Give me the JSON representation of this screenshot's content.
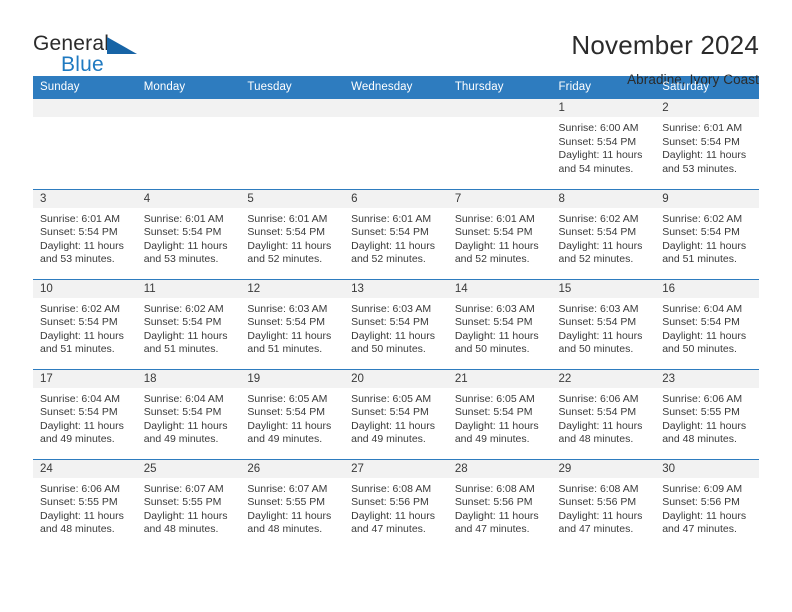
{
  "brand": {
    "name_part1": "General",
    "name_part2": "Blue",
    "logo_icon": "triangle-icon"
  },
  "header": {
    "title": "November 2024",
    "subtitle": "Abradine, Ivory Coast"
  },
  "colors": {
    "header_blue": "#2e7cbf",
    "brand_blue": "#1f7ac1",
    "daynum_background": "#f2f2f2",
    "text": "#3a3a3a"
  },
  "weekday_headers": [
    "Sunday",
    "Monday",
    "Tuesday",
    "Wednesday",
    "Thursday",
    "Friday",
    "Saturday"
  ],
  "weeks": [
    [
      {
        "day": "",
        "sunrise": "",
        "sunset": "",
        "daylight": "",
        "empty": true
      },
      {
        "day": "",
        "sunrise": "",
        "sunset": "",
        "daylight": "",
        "empty": true
      },
      {
        "day": "",
        "sunrise": "",
        "sunset": "",
        "daylight": "",
        "empty": true
      },
      {
        "day": "",
        "sunrise": "",
        "sunset": "",
        "daylight": "",
        "empty": true
      },
      {
        "day": "",
        "sunrise": "",
        "sunset": "",
        "daylight": "",
        "empty": true
      },
      {
        "day": "1",
        "sunrise": "Sunrise: 6:00 AM",
        "sunset": "Sunset: 5:54 PM",
        "daylight": "Daylight: 11 hours and 54 minutes.",
        "empty": false
      },
      {
        "day": "2",
        "sunrise": "Sunrise: 6:01 AM",
        "sunset": "Sunset: 5:54 PM",
        "daylight": "Daylight: 11 hours and 53 minutes.",
        "empty": false
      }
    ],
    [
      {
        "day": "3",
        "sunrise": "Sunrise: 6:01 AM",
        "sunset": "Sunset: 5:54 PM",
        "daylight": "Daylight: 11 hours and 53 minutes.",
        "empty": false
      },
      {
        "day": "4",
        "sunrise": "Sunrise: 6:01 AM",
        "sunset": "Sunset: 5:54 PM",
        "daylight": "Daylight: 11 hours and 53 minutes.",
        "empty": false
      },
      {
        "day": "5",
        "sunrise": "Sunrise: 6:01 AM",
        "sunset": "Sunset: 5:54 PM",
        "daylight": "Daylight: 11 hours and 52 minutes.",
        "empty": false
      },
      {
        "day": "6",
        "sunrise": "Sunrise: 6:01 AM",
        "sunset": "Sunset: 5:54 PM",
        "daylight": "Daylight: 11 hours and 52 minutes.",
        "empty": false
      },
      {
        "day": "7",
        "sunrise": "Sunrise: 6:01 AM",
        "sunset": "Sunset: 5:54 PM",
        "daylight": "Daylight: 11 hours and 52 minutes.",
        "empty": false
      },
      {
        "day": "8",
        "sunrise": "Sunrise: 6:02 AM",
        "sunset": "Sunset: 5:54 PM",
        "daylight": "Daylight: 11 hours and 52 minutes.",
        "empty": false
      },
      {
        "day": "9",
        "sunrise": "Sunrise: 6:02 AM",
        "sunset": "Sunset: 5:54 PM",
        "daylight": "Daylight: 11 hours and 51 minutes.",
        "empty": false
      }
    ],
    [
      {
        "day": "10",
        "sunrise": "Sunrise: 6:02 AM",
        "sunset": "Sunset: 5:54 PM",
        "daylight": "Daylight: 11 hours and 51 minutes.",
        "empty": false
      },
      {
        "day": "11",
        "sunrise": "Sunrise: 6:02 AM",
        "sunset": "Sunset: 5:54 PM",
        "daylight": "Daylight: 11 hours and 51 minutes.",
        "empty": false
      },
      {
        "day": "12",
        "sunrise": "Sunrise: 6:03 AM",
        "sunset": "Sunset: 5:54 PM",
        "daylight": "Daylight: 11 hours and 51 minutes.",
        "empty": false
      },
      {
        "day": "13",
        "sunrise": "Sunrise: 6:03 AM",
        "sunset": "Sunset: 5:54 PM",
        "daylight": "Daylight: 11 hours and 50 minutes.",
        "empty": false
      },
      {
        "day": "14",
        "sunrise": "Sunrise: 6:03 AM",
        "sunset": "Sunset: 5:54 PM",
        "daylight": "Daylight: 11 hours and 50 minutes.",
        "empty": false
      },
      {
        "day": "15",
        "sunrise": "Sunrise: 6:03 AM",
        "sunset": "Sunset: 5:54 PM",
        "daylight": "Daylight: 11 hours and 50 minutes.",
        "empty": false
      },
      {
        "day": "16",
        "sunrise": "Sunrise: 6:04 AM",
        "sunset": "Sunset: 5:54 PM",
        "daylight": "Daylight: 11 hours and 50 minutes.",
        "empty": false
      }
    ],
    [
      {
        "day": "17",
        "sunrise": "Sunrise: 6:04 AM",
        "sunset": "Sunset: 5:54 PM",
        "daylight": "Daylight: 11 hours and 49 minutes.",
        "empty": false
      },
      {
        "day": "18",
        "sunrise": "Sunrise: 6:04 AM",
        "sunset": "Sunset: 5:54 PM",
        "daylight": "Daylight: 11 hours and 49 minutes.",
        "empty": false
      },
      {
        "day": "19",
        "sunrise": "Sunrise: 6:05 AM",
        "sunset": "Sunset: 5:54 PM",
        "daylight": "Daylight: 11 hours and 49 minutes.",
        "empty": false
      },
      {
        "day": "20",
        "sunrise": "Sunrise: 6:05 AM",
        "sunset": "Sunset: 5:54 PM",
        "daylight": "Daylight: 11 hours and 49 minutes.",
        "empty": false
      },
      {
        "day": "21",
        "sunrise": "Sunrise: 6:05 AM",
        "sunset": "Sunset: 5:54 PM",
        "daylight": "Daylight: 11 hours and 49 minutes.",
        "empty": false
      },
      {
        "day": "22",
        "sunrise": "Sunrise: 6:06 AM",
        "sunset": "Sunset: 5:54 PM",
        "daylight": "Daylight: 11 hours and 48 minutes.",
        "empty": false
      },
      {
        "day": "23",
        "sunrise": "Sunrise: 6:06 AM",
        "sunset": "Sunset: 5:55 PM",
        "daylight": "Daylight: 11 hours and 48 minutes.",
        "empty": false
      }
    ],
    [
      {
        "day": "24",
        "sunrise": "Sunrise: 6:06 AM",
        "sunset": "Sunset: 5:55 PM",
        "daylight": "Daylight: 11 hours and 48 minutes.",
        "empty": false
      },
      {
        "day": "25",
        "sunrise": "Sunrise: 6:07 AM",
        "sunset": "Sunset: 5:55 PM",
        "daylight": "Daylight: 11 hours and 48 minutes.",
        "empty": false
      },
      {
        "day": "26",
        "sunrise": "Sunrise: 6:07 AM",
        "sunset": "Sunset: 5:55 PM",
        "daylight": "Daylight: 11 hours and 48 minutes.",
        "empty": false
      },
      {
        "day": "27",
        "sunrise": "Sunrise: 6:08 AM",
        "sunset": "Sunset: 5:56 PM",
        "daylight": "Daylight: 11 hours and 47 minutes.",
        "empty": false
      },
      {
        "day": "28",
        "sunrise": "Sunrise: 6:08 AM",
        "sunset": "Sunset: 5:56 PM",
        "daylight": "Daylight: 11 hours and 47 minutes.",
        "empty": false
      },
      {
        "day": "29",
        "sunrise": "Sunrise: 6:08 AM",
        "sunset": "Sunset: 5:56 PM",
        "daylight": "Daylight: 11 hours and 47 minutes.",
        "empty": false
      },
      {
        "day": "30",
        "sunrise": "Sunrise: 6:09 AM",
        "sunset": "Sunset: 5:56 PM",
        "daylight": "Daylight: 11 hours and 47 minutes.",
        "empty": false
      }
    ]
  ]
}
